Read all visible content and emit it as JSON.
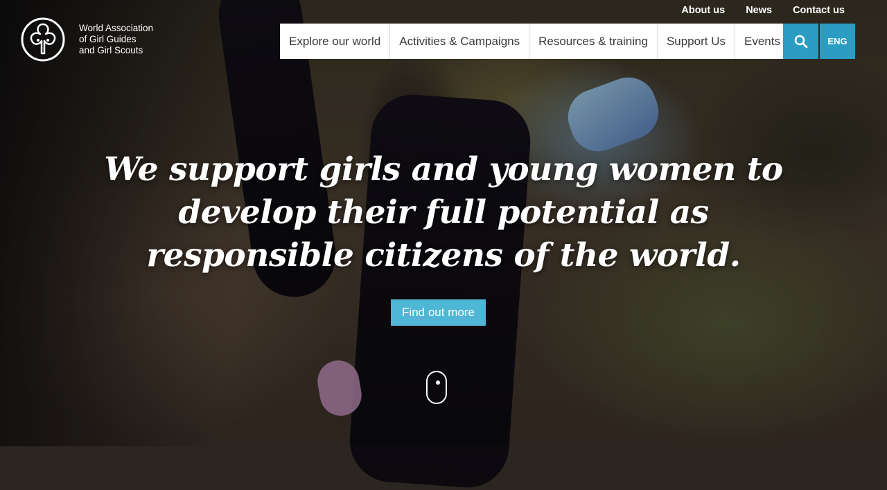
{
  "logo": {
    "icon": "trefoil-icon",
    "lines": [
      "World Association",
      "of Girl Guides",
      "and Girl Scouts"
    ]
  },
  "utility_nav": [
    "About us",
    "News",
    "Contact us"
  ],
  "main_nav": [
    "Explore our world",
    "Activities & Campaigns",
    "Resources & training",
    "Support Us",
    "Events"
  ],
  "search": {
    "icon": "search-icon"
  },
  "language": {
    "label": "ENG"
  },
  "hero": {
    "headline_lines": [
      "We support girls and young women to",
      "develop their full potential as",
      "responsible citizens of the world."
    ],
    "cta_label": "Find out more",
    "scroll_icon": "mouse-scroll-icon"
  },
  "colors": {
    "accent": "#2c9dc2",
    "cta": "#4fb7d5",
    "nav_bg": "#ffffff",
    "nav_text": "#3a3a3a"
  }
}
